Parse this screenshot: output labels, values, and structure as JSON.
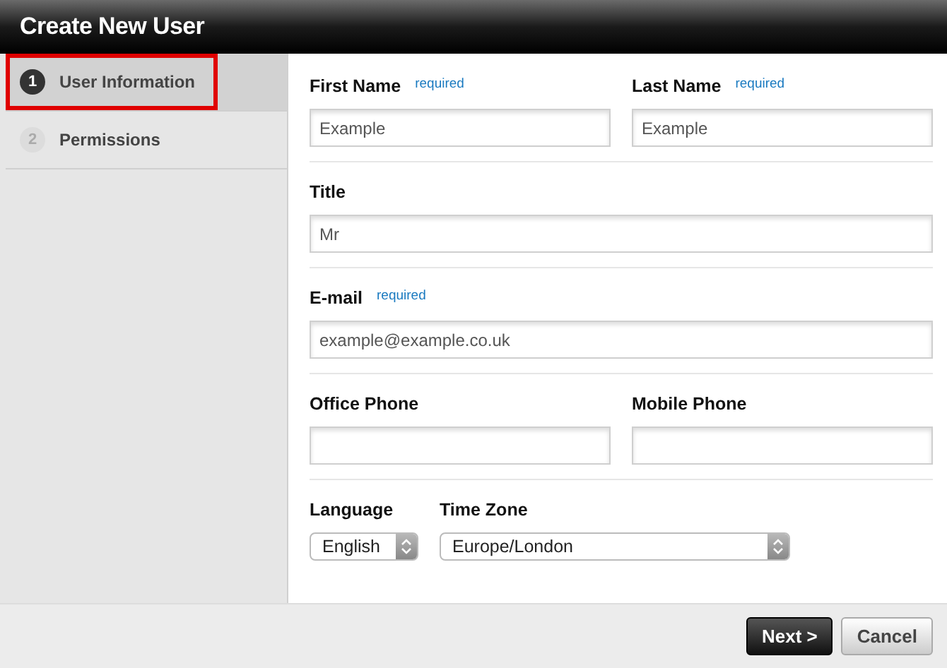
{
  "window": {
    "title": "Create New User"
  },
  "steps": [
    {
      "number": "1",
      "label": "User Information",
      "selected": true
    },
    {
      "number": "2",
      "label": "Permissions",
      "selected": false
    }
  ],
  "rows": [
    {
      "fields": [
        {
          "kind": "text",
          "label": "First Name",
          "note": "required",
          "value": "Example"
        },
        {
          "kind": "text",
          "label": "Last Name",
          "note": "required",
          "value": "Example"
        }
      ]
    },
    {
      "fields": [
        {
          "kind": "text",
          "label": "Title",
          "value": "Mr"
        }
      ]
    },
    {
      "fields": [
        {
          "kind": "text",
          "label": "E-mail",
          "note": "required",
          "value": "example@example.co.uk"
        }
      ]
    },
    {
      "fields": [
        {
          "kind": "text",
          "label": "Office Phone"
        },
        {
          "kind": "text",
          "label": "Mobile Phone"
        }
      ]
    },
    {
      "fields": [
        {
          "kind": "select",
          "label": "Language",
          "value": "English"
        },
        {
          "kind": "select",
          "label": "Time Zone",
          "value": "Europe/London",
          "wide": true
        }
      ]
    }
  ],
  "buttons": [
    {
      "label": "Next >",
      "primary": true
    },
    {
      "label": "Cancel",
      "primary": false
    }
  ]
}
